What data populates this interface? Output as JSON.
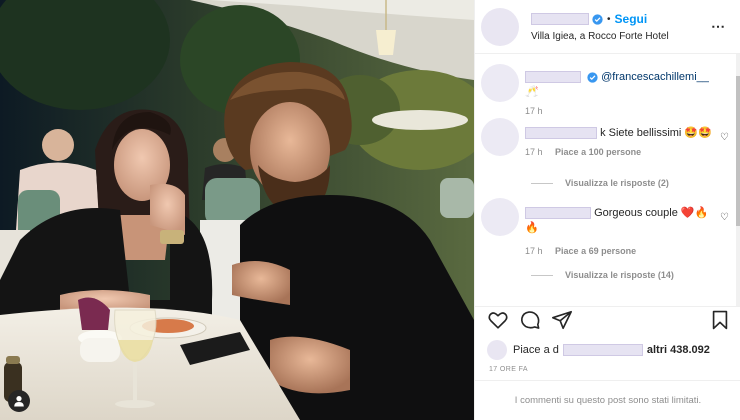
{
  "post": {
    "follow_label": "Segui",
    "location": "Villa Igiea, a Rocco Forte Hotel",
    "more_icon": "⋯"
  },
  "comments": [
    {
      "text": "@francescachillemi__ 🥂",
      "time": "17 h",
      "verified": true
    },
    {
      "text": "k Siete bellissimi 🤩🤩",
      "time": "17 h",
      "likes": "Piace a 100 persone",
      "replies": "Visualizza le risposte (2)"
    },
    {
      "text": "Gorgeous couple ❤️🔥🔥",
      "time": "17 h",
      "likes": "Piace a 69 persone",
      "replies": "Visualizza le risposte (14)"
    }
  ],
  "likes": {
    "prefix": "Piace a d",
    "suffix": "altri 438.092"
  },
  "time_ago": "17 ORE FA",
  "limited_notice": "I commenti su questo post sono stati limitati.",
  "colors": {
    "accent": "#0095f6",
    "verified": "#3897f0",
    "redaction": "#e6e3f2"
  }
}
